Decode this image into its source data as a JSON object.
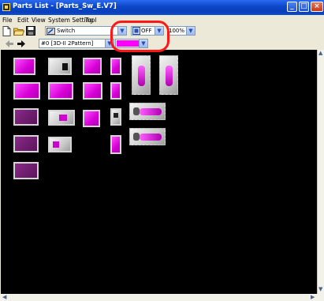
{
  "window": {
    "title": "Parts List - [Parts_Sw_E.V7]",
    "controls": [
      "minimize",
      "maximize",
      "close"
    ]
  },
  "menu": {
    "items": [
      "File",
      "Edit",
      "View",
      "System Setting",
      "Tool"
    ]
  },
  "toolbar": {
    "part_type": "Switch",
    "state": "OFF",
    "zoom": "100%"
  },
  "toolbar2": {
    "pattern": "#0 [3D-II 2Pattern]",
    "color_hex": "#ff00ff"
  },
  "canvas": {
    "background": "#000000"
  },
  "colors": {
    "accent": "#ff00ff",
    "highlight": "#ff1717",
    "titlebar": "#0b46c8"
  }
}
